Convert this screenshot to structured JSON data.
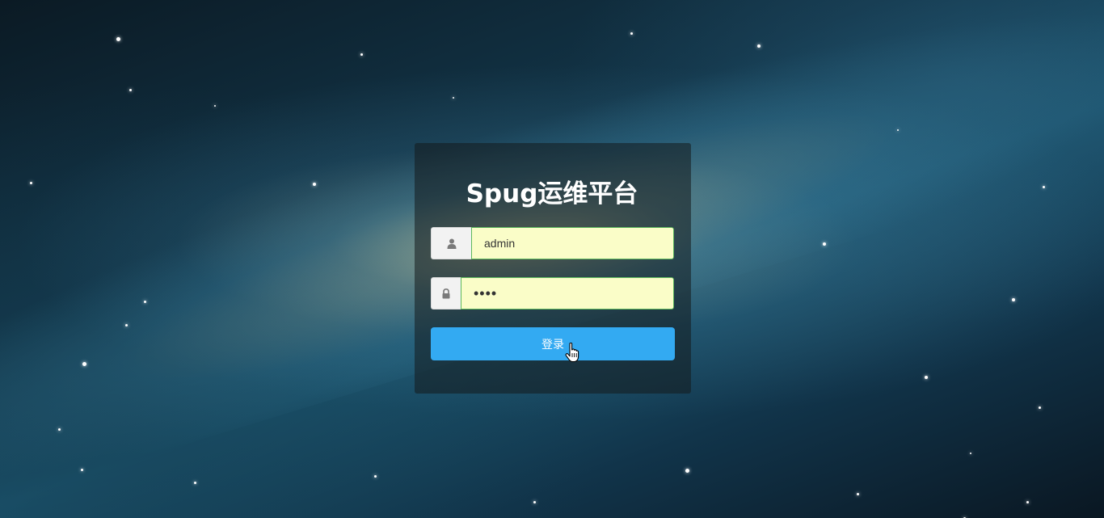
{
  "login": {
    "title": "Spug运维平台",
    "username": {
      "icon": "user-icon",
      "value": "admin"
    },
    "password": {
      "icon": "lock-icon",
      "value": "••••"
    },
    "submit_label": "登录"
  },
  "colors": {
    "button": "#33aaf2",
    "input_background": "#fafdc8",
    "input_border": "#5cb85c"
  }
}
